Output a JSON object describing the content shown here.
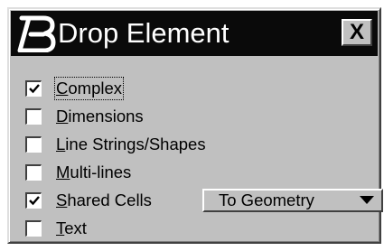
{
  "window": {
    "title": "Drop Element",
    "logo_icon": "microstation-logo-icon",
    "close_label": "X"
  },
  "options": [
    {
      "id": "complex",
      "label": "Complex",
      "accel": "C",
      "rest": "omplex",
      "checked": true,
      "focused": true
    },
    {
      "id": "dimensions",
      "label": "Dimensions",
      "accel": "D",
      "rest": "imensions",
      "checked": false
    },
    {
      "id": "line-strings-shapes",
      "label": "Line Strings/Shapes",
      "accel": "L",
      "rest": "ine Strings/Shapes",
      "checked": false
    },
    {
      "id": "multi-lines",
      "label": "Multi-lines",
      "accel": "M",
      "rest": "ulti-lines",
      "checked": false
    },
    {
      "id": "shared-cells",
      "label": "Shared Cells",
      "accel": "S",
      "rest": "hared Cells",
      "checked": true
    },
    {
      "id": "text",
      "label": "Text",
      "accel": "T",
      "rest": "ext",
      "checked": false
    }
  ],
  "shared_cells_dropdown": {
    "selected": "To Geometry"
  },
  "colors": {
    "titlebar": "#0a0a0a",
    "face": "#c0c0c0"
  }
}
